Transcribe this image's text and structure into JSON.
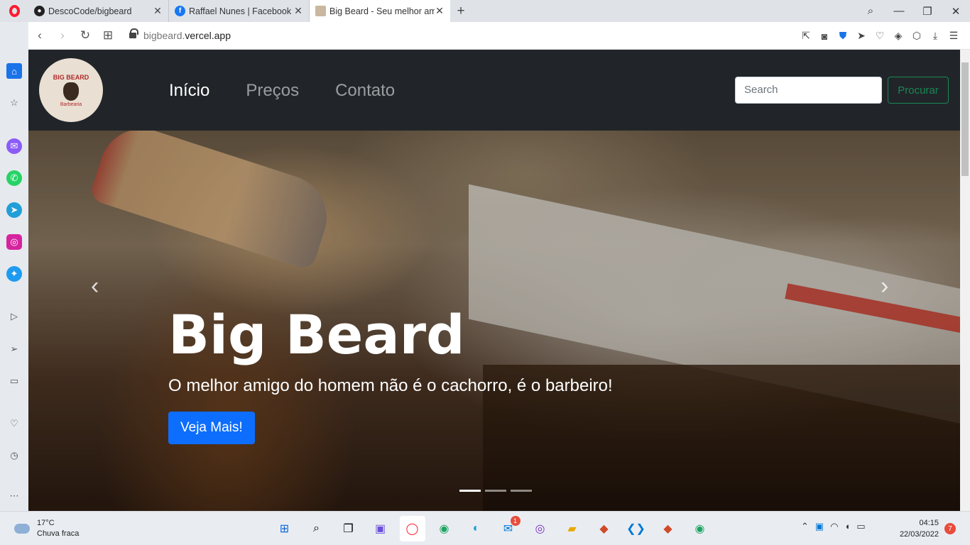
{
  "browser": {
    "tabs": [
      {
        "title": "DescoCode/bigbeard",
        "icon": "github-icon"
      },
      {
        "title": "Raffael Nunes | Facebook",
        "icon": "facebook-icon"
      },
      {
        "title": "Big Beard - Seu melhor amigo",
        "icon": "bigbeard-favicon-icon"
      }
    ],
    "new_tab": "+",
    "address": {
      "domain_prefix": "bigbeard.",
      "domain_rest": "vercel.app"
    }
  },
  "site": {
    "logo": {
      "top_text": "BIG BEARD",
      "bottom_text": "Barbearia"
    },
    "nav": [
      "Início",
      "Preços",
      "Contato"
    ],
    "search_placeholder": "Search",
    "search_button": "Procurar",
    "hero": {
      "title": "Big Beard",
      "subtitle": "O melhor amigo do homem não é o cachorro, é o barbeiro!",
      "button": "Veja Mais!",
      "slides": 3,
      "active_slide": 1
    }
  },
  "taskbar": {
    "weather_temp": "17°C",
    "weather_desc": "Chuva fraca",
    "mail_badge": "1",
    "time": "04:15",
    "date": "22/03/2022",
    "notifications": "7"
  },
  "colors": {
    "navbar": "#212529",
    "primary": "#0d6efd",
    "success": "#198754"
  }
}
